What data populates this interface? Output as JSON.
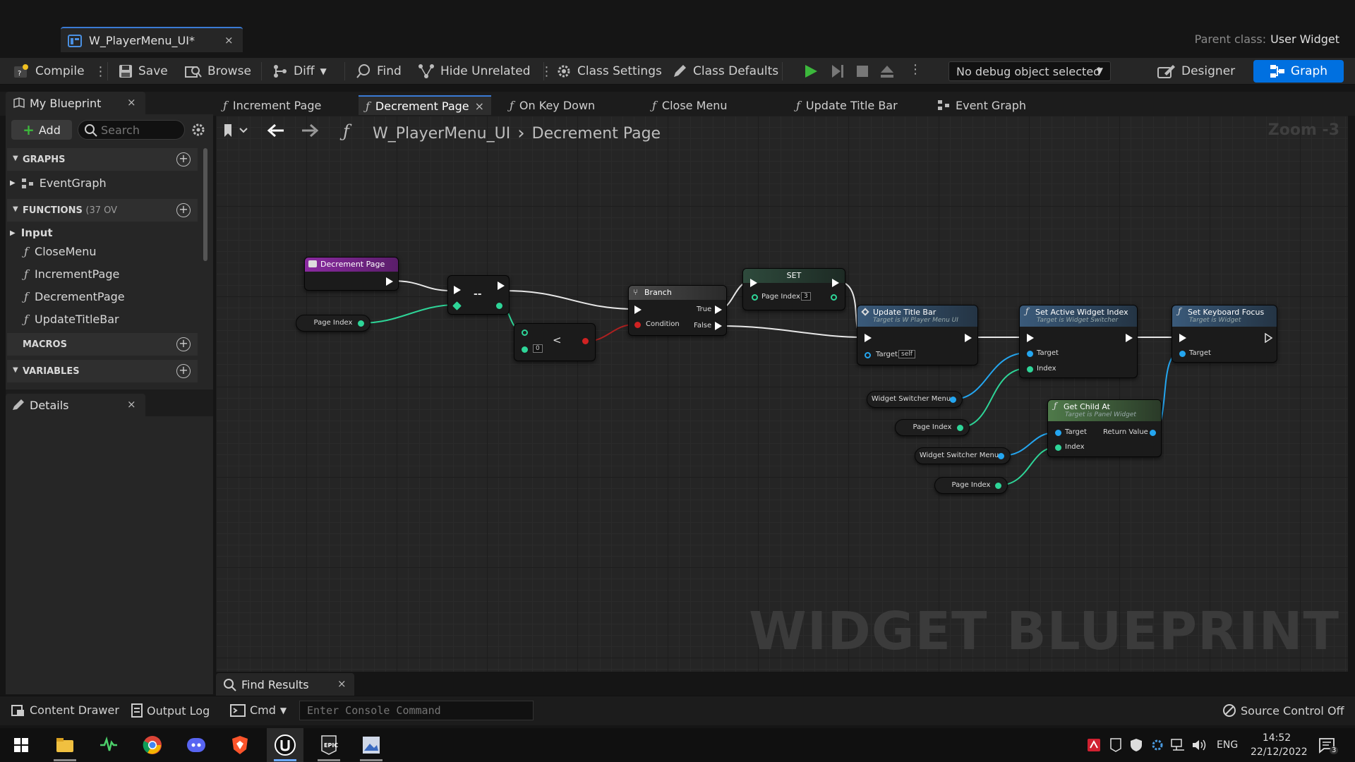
{
  "document_tab": {
    "title": "W_PlayerMenu_UI*",
    "close": "×"
  },
  "parent_class": {
    "label": "Parent class:",
    "value": "User Widget"
  },
  "toolbar": {
    "compile": "Compile",
    "save": "Save",
    "browse": "Browse",
    "diff": "Diff",
    "find": "Find",
    "hide_unrelated": "Hide Unrelated",
    "class_settings": "Class Settings",
    "class_defaults": "Class Defaults",
    "debug_object": "No debug object selected",
    "designer": "Designer",
    "graph": "Graph"
  },
  "function_tabs": [
    {
      "label": "Increment Page"
    },
    {
      "label": "Decrement Page",
      "close": "×"
    },
    {
      "label": "On Key Down"
    },
    {
      "label": "Close Menu"
    },
    {
      "label": "Update Title Bar"
    },
    {
      "label": "Event Graph"
    }
  ],
  "my_blueprint": {
    "tab": "My Blueprint",
    "close": "×",
    "add": "Add",
    "search_placeholder": "Search",
    "graphs_header": "GRAPHS",
    "event_graph": "EventGraph",
    "functions_header": "FUNCTIONS",
    "functions_count": "(37 OV",
    "input_category": "Input",
    "functions": [
      "CloseMenu",
      "IncrementPage",
      "DecrementPage",
      "UpdateTitleBar"
    ],
    "macros_header": "MACROS",
    "variables_header": "VARIABLES"
  },
  "details": {
    "tab": "Details",
    "close": "×"
  },
  "breadcrumb": {
    "root": "W_PlayerMenu_UI",
    "separator": "›",
    "current": "Decrement Page"
  },
  "zoom": "Zoom -3",
  "watermark": "WIDGET BLUEPRINT",
  "nodes": {
    "entry": {
      "title": "Decrement Page"
    },
    "decrement": {
      "op": "--"
    },
    "less_than": {
      "op": "<",
      "value": "0"
    },
    "branch": {
      "title": "Branch",
      "true": "True",
      "false": "False",
      "condition": "Condition"
    },
    "set": {
      "title": "SET",
      "pin": "Page Index",
      "value": "3"
    },
    "update_title_bar": {
      "title": "Update Title Bar",
      "subtitle": "Target is W Player Menu UI",
      "target": "Target",
      "self": "self"
    },
    "set_active_widget_index": {
      "title": "Set Active Widget Index",
      "subtitle": "Target is Widget Switcher",
      "target": "Target",
      "index": "Index"
    },
    "set_keyboard_focus": {
      "title": "Set Keyboard Focus",
      "subtitle": "Target is Widget",
      "target": "Target"
    },
    "get_child_at": {
      "title": "Get Child At",
      "subtitle": "Target is Panel Widget",
      "target": "Target",
      "return_value": "Return Value",
      "index": "Index"
    },
    "vars": {
      "page_index_1": "Page Index",
      "widget_switcher_1": "Widget Switcher Menu",
      "page_index_2": "Page Index",
      "widget_switcher_2": "Widget Switcher Menu",
      "page_index_3": "Page Index"
    }
  },
  "find_results": {
    "tab": "Find Results",
    "close": "×"
  },
  "statusbar": {
    "content_drawer": "Content Drawer",
    "output_log": "Output Log",
    "cmd": "Cmd",
    "console_placeholder": "Enter Console Command",
    "source_control": "Source Control Off"
  },
  "taskbar": {
    "language": "ENG",
    "time": "14:52",
    "date": "22/12/2022",
    "notifications": "3"
  },
  "colors": {
    "accent": "#0070e0",
    "float_pin": "#2ed598",
    "object_pin": "#24a6f0",
    "bool_pin": "#d02222"
  }
}
